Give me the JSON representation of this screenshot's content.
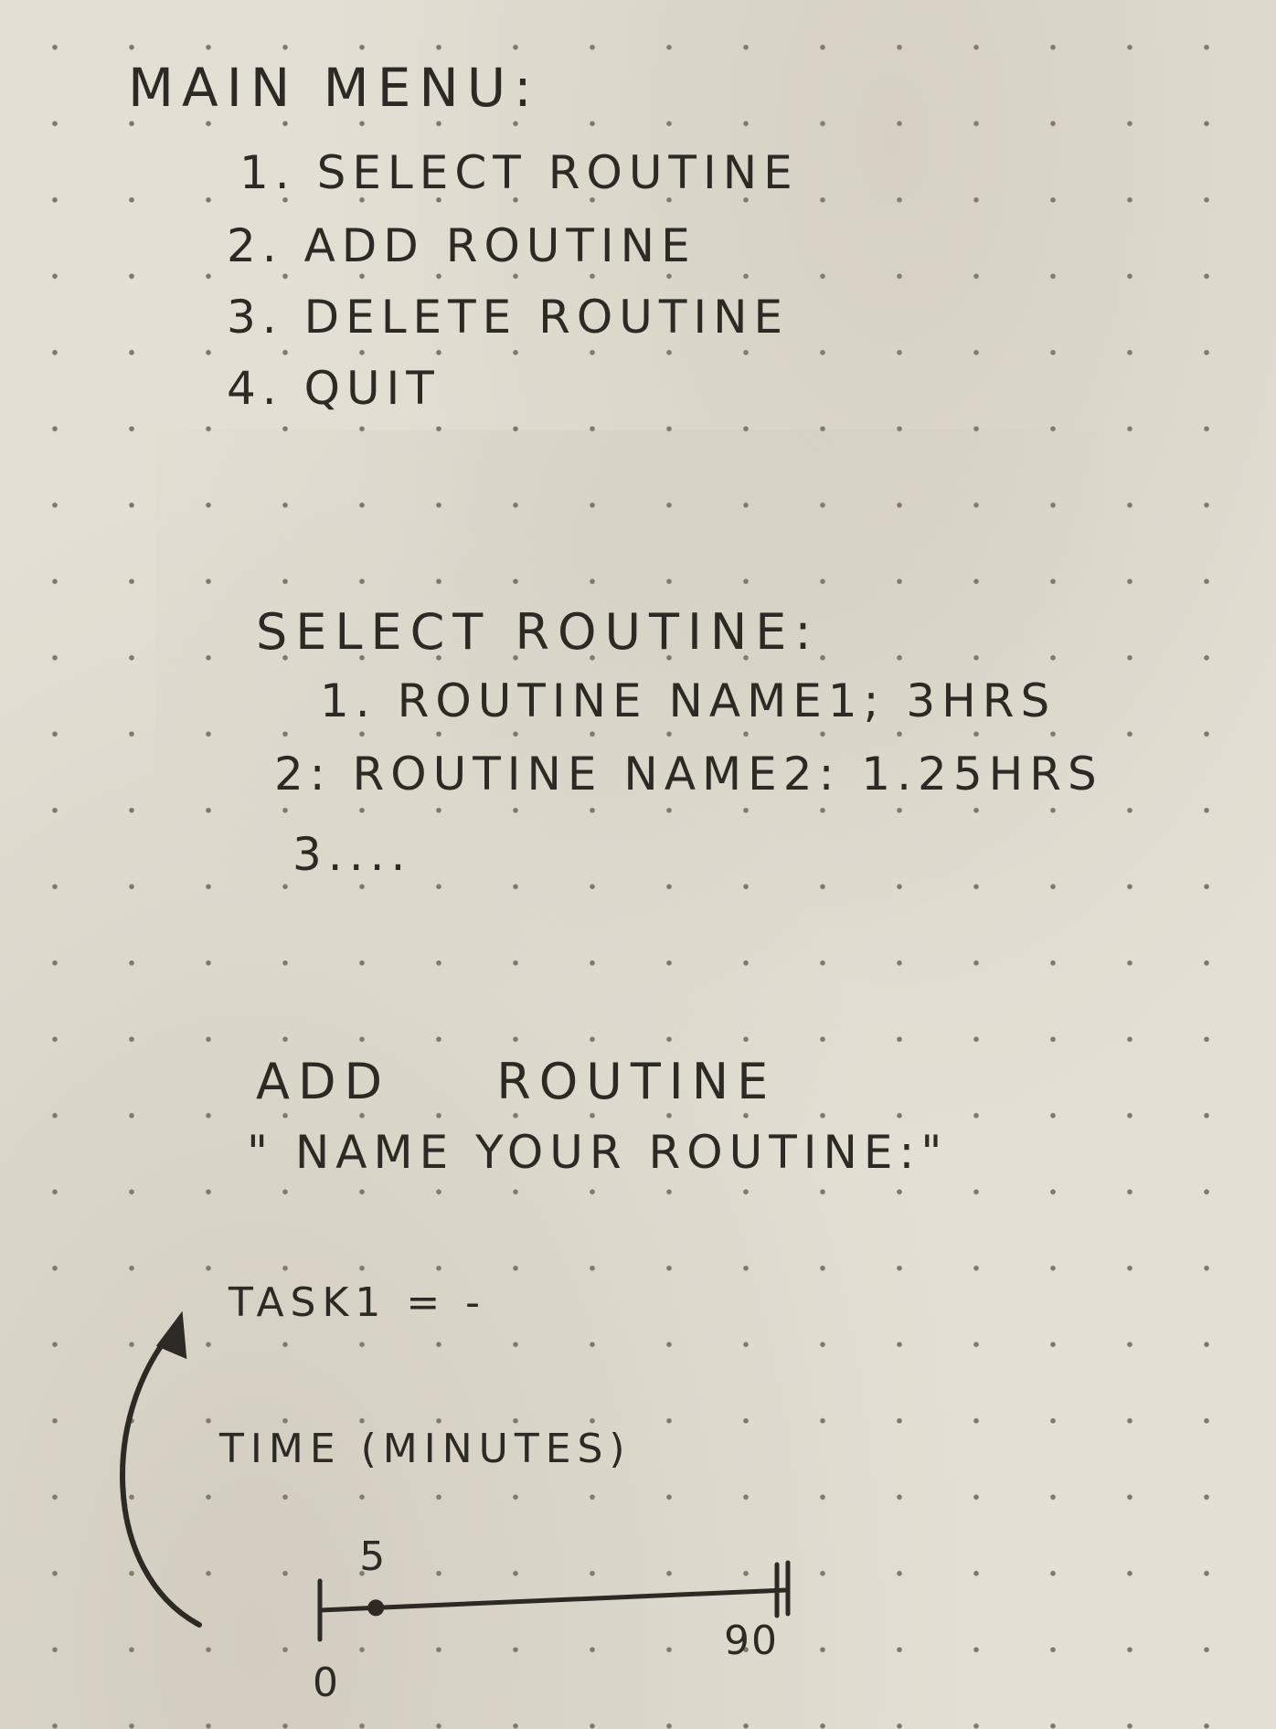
{
  "main_menu": {
    "title": "MAIN MENU:",
    "items": [
      "1. SELECT ROUTINE",
      "2. ADD ROUTINE",
      "3. DELETE ROUTINE",
      "4. QUIT"
    ]
  },
  "select_routine": {
    "title": "SELECT ROUTINE:",
    "items": [
      "1. ROUTINE NAME1; 3HRS",
      "2: ROUTINE NAME2: 1.25HRS",
      "3...."
    ]
  },
  "add_routine": {
    "title": "ADD ROUTINE",
    "prompt": "\" NAME YOUR ROUTINE:\"",
    "task_label": "TASK1 = -",
    "time_label": "TIME (MINUTES)"
  },
  "time_slider": {
    "min_label": "0",
    "max_label": "90",
    "value_label": "5",
    "min": 0,
    "max": 90,
    "value": 5
  },
  "ink_color": "#2d2924",
  "paper_color": "#e3dfd4"
}
